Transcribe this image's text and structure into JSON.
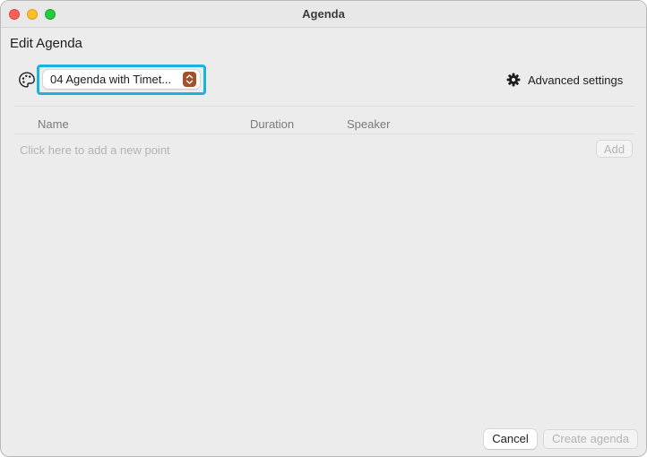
{
  "window": {
    "title": "Agenda"
  },
  "page": {
    "heading": "Edit Agenda"
  },
  "toolbar": {
    "template_select": {
      "value": "04 Agenda with Timet...",
      "icon": "chevron-up-down-icon"
    },
    "palette_icon": "palette-icon",
    "advanced_settings": {
      "icon": "gear-icon",
      "label": "Advanced settings"
    }
  },
  "table": {
    "columns": [
      "Name",
      "Duration",
      "Speaker"
    ],
    "new_point_placeholder": "Click here to add a new point",
    "add_label": "Add"
  },
  "footer": {
    "cancel_label": "Cancel",
    "create_label": "Create agenda"
  },
  "colors": {
    "focus_ring": "#1ab3de",
    "stepper": "#a0522d",
    "window_bg": "#ececec"
  }
}
